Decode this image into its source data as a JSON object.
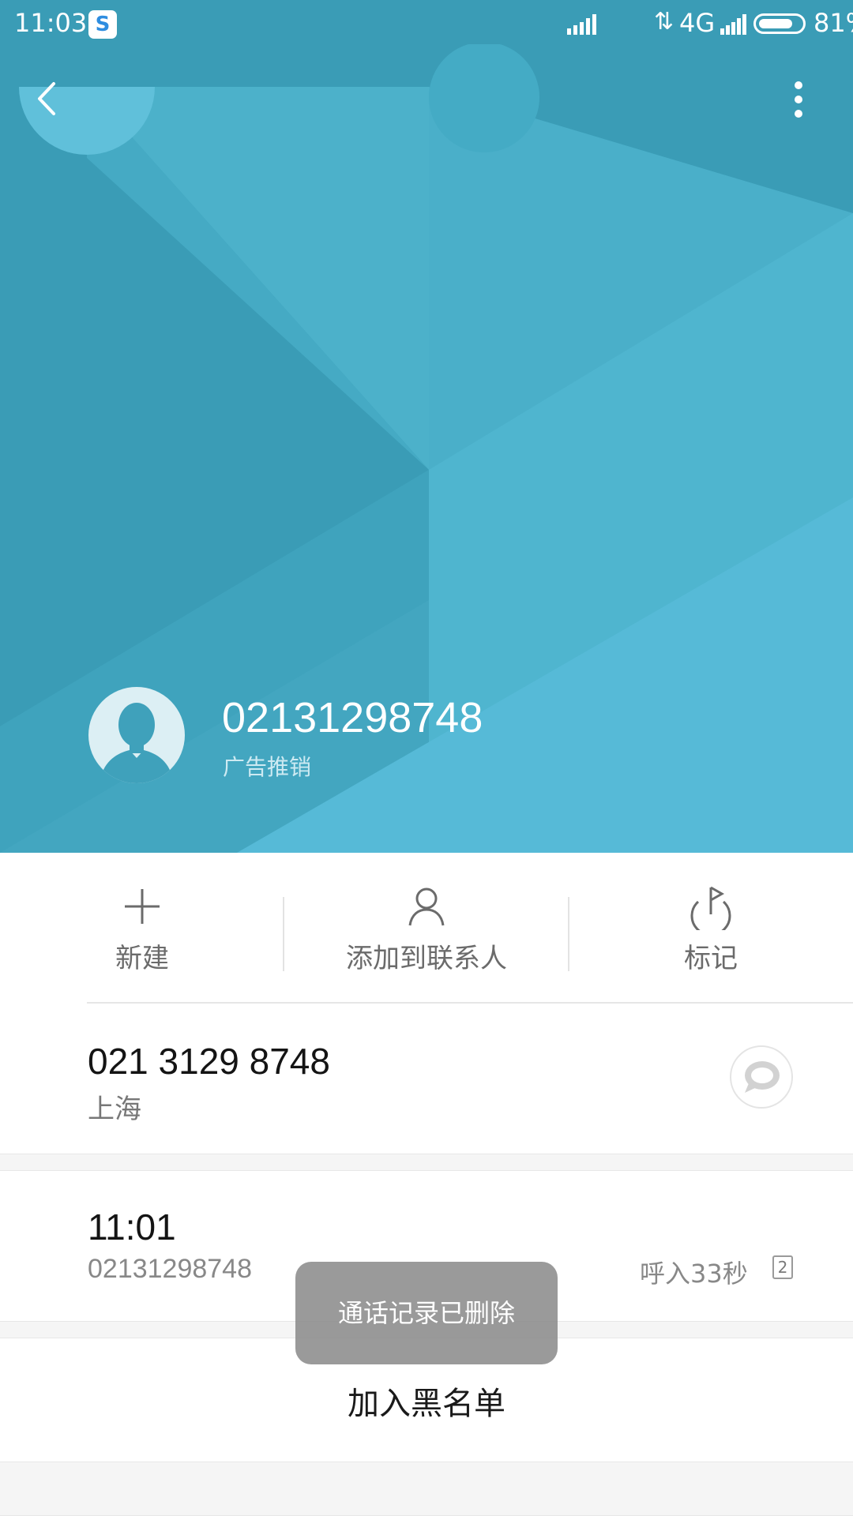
{
  "status_bar": {
    "time": "11:03",
    "app_badge": "S",
    "network": "4G",
    "battery_percent_text": "81%",
    "battery_level": 0.81
  },
  "header": {
    "back_icon": "chevron-left-icon",
    "more_icon": "more-vertical-icon",
    "background_color": "#3a9cb6",
    "number": "02131298748",
    "tag": "广告推销"
  },
  "actions": [
    {
      "label": "新建",
      "icon": "plus-icon"
    },
    {
      "label": "添加到联系人",
      "icon": "person-icon"
    },
    {
      "label": "标记",
      "icon": "flag-icon"
    }
  ],
  "phone": {
    "formatted": "021 3129 8748",
    "location": "上海",
    "message_icon": "message-icon"
  },
  "call_log": {
    "time": "11:01",
    "number": "02131298748",
    "type": "呼入33秒",
    "sim": "2"
  },
  "blacklist": {
    "label": "加入黑名单"
  },
  "toast": {
    "message": "通话记录已删除"
  }
}
